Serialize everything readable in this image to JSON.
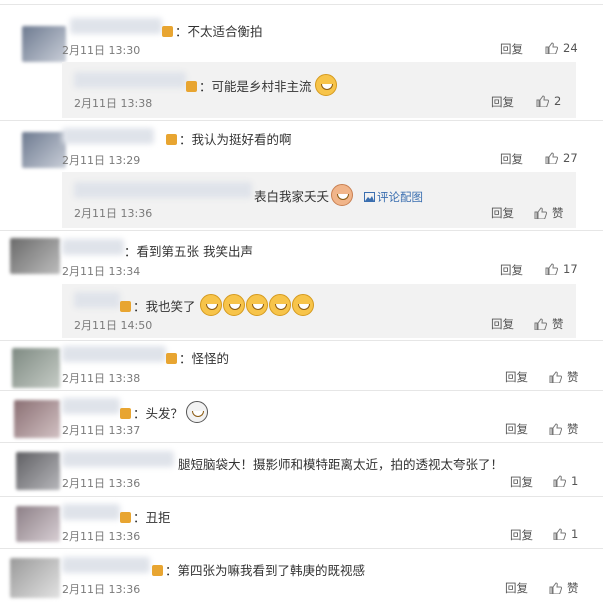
{
  "comments": [
    {
      "text": "：不太适合衡拍",
      "time": "2月11日 13:30",
      "reply": "回复",
      "likes": "24"
    },
    {
      "text": "：可能是乡村非主流",
      "time": "2月11日 13:38",
      "reply": "回复",
      "likes": "2"
    },
    {
      "text": "：我认为挺好看的啊",
      "time": "2月11日 13:29",
      "reply": "回复",
      "likes": "27"
    },
    {
      "text": "表白我家夭夭",
      "pic_link": "评论配图",
      "time": "2月11日 13:36",
      "reply": "回复",
      "likes": "赞"
    },
    {
      "text": "：看到第五张 我笑出声",
      "time": "2月11日 13:34",
      "reply": "回复",
      "likes": "17"
    },
    {
      "text": "：我也笑了",
      "time": "2月11日 14:50",
      "reply": "回复",
      "likes": "赞"
    },
    {
      "text": "：怪怪的",
      "time": "2月11日 13:38",
      "reply": "回复",
      "likes": "赞"
    },
    {
      "text": "：头发？",
      "time": "2月11日 13:37",
      "reply": "回复",
      "likes": "赞"
    },
    {
      "text": "腿短脑袋大！摄影师和模特距离太近，拍的透视太夸张了！",
      "time": "2月11日 13:36",
      "reply": "回复",
      "likes": "1"
    },
    {
      "text": "：丑拒",
      "time": "2月11日 13:36",
      "reply": "回复",
      "likes": "1"
    },
    {
      "text": "：第四张为嘛我看到了韩庚的既视感",
      "time": "2月11日 13:36",
      "reply": "回复",
      "likes": "赞"
    }
  ],
  "icons": {
    "like": "thumbs-up-icon",
    "member": "member-badge-icon",
    "emoji": "laugh-emoji-icon",
    "picture": "picture-icon"
  }
}
